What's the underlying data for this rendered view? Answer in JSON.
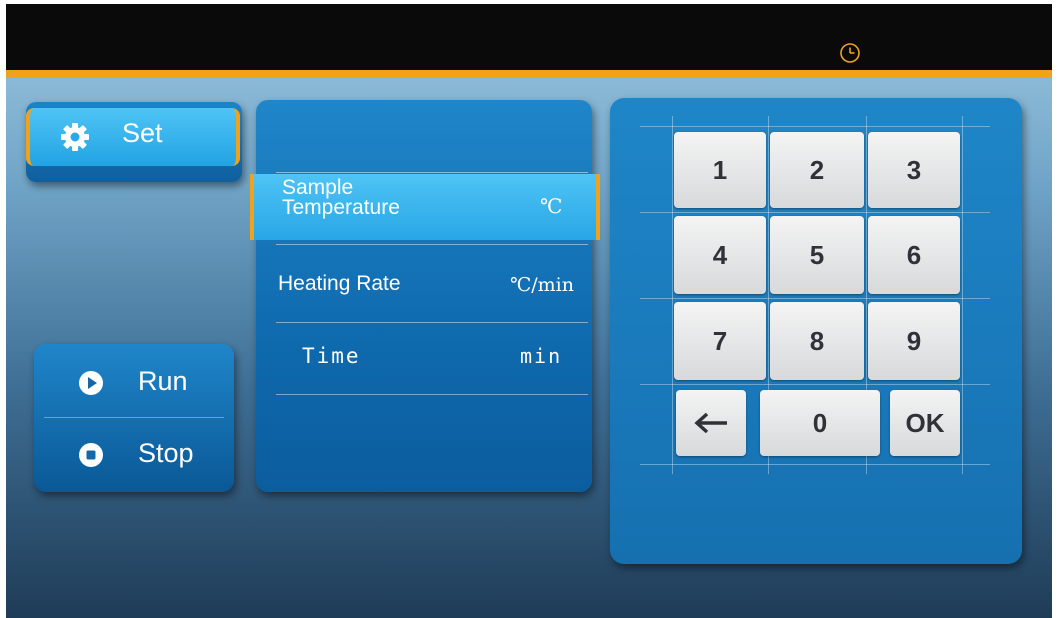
{
  "header": {
    "clock_icon": "clock-icon",
    "accent_color": "#f0a21a"
  },
  "nav": {
    "set": {
      "label": "Set",
      "icon": "gear-icon"
    },
    "run": {
      "label": "Run",
      "icon": "play-icon"
    },
    "stop": {
      "label": "Stop",
      "icon": "stop-icon"
    }
  },
  "params": {
    "rows": [
      {
        "label": "Sample Temperature",
        "label_line1": "Sample",
        "label_line2": "Temperature",
        "unit": "℃",
        "selected": true
      },
      {
        "label": "Heating Rate",
        "unit": "℃/min",
        "selected": false
      },
      {
        "label": "Time",
        "unit": "min",
        "selected": false
      }
    ]
  },
  "keypad": {
    "keys": [
      "1",
      "2",
      "3",
      "4",
      "5",
      "6",
      "7",
      "8",
      "9",
      "0"
    ],
    "backspace_icon": "arrow-left-icon",
    "ok_label": "OK"
  }
}
